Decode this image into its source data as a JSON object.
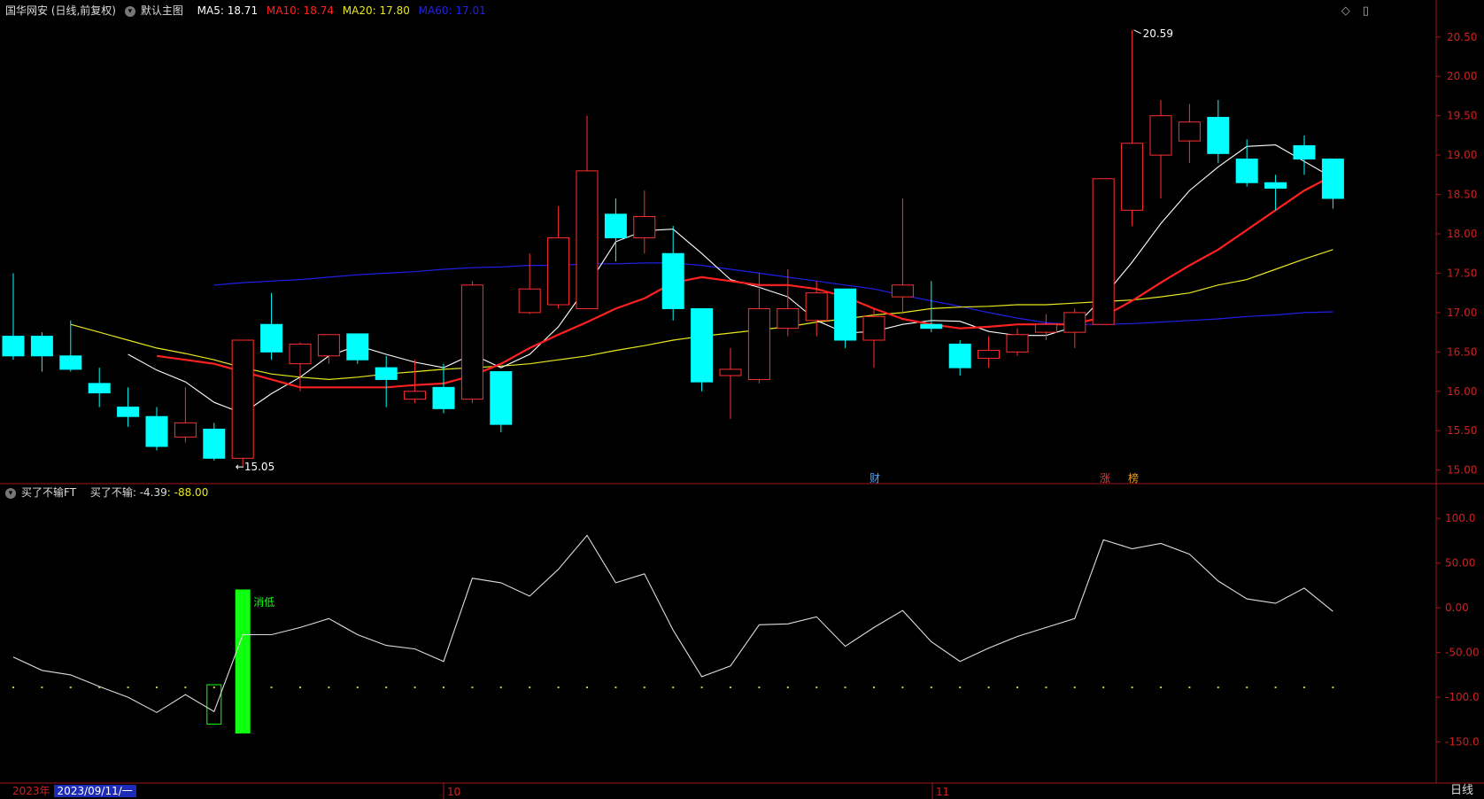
{
  "header": {
    "stock_title": "国华网安 (日线,前复权)",
    "main_chart_label": "默认主图",
    "ma5_label": "MA5: 18.71",
    "ma10_label": "MA10: 18.74",
    "ma20_label": "MA20: 17.80",
    "ma60_label": "MA60: 17.01",
    "colors": {
      "ma5": "#ffffff",
      "ma10": "#ff2020",
      "ma20": "#e8e820",
      "ma60": "#2020e8"
    }
  },
  "sub_header": {
    "indicator_name": "买了不输FT",
    "indicator_label": "买了不输: -4.39",
    "indicator_value": ": -88.00"
  },
  "window_icons": [
    "diamond-icon",
    "document-icon"
  ],
  "price_axis": {
    "ticks": [
      "20.50",
      "20.00",
      "19.50",
      "19.00",
      "18.50",
      "18.00",
      "17.50",
      "17.00",
      "16.50",
      "16.00",
      "15.50",
      "15.00"
    ]
  },
  "indicator_axis": {
    "ticks": [
      "100.0",
      "50.00",
      "0.00",
      "-50.00",
      "-100.0",
      "-150.0"
    ]
  },
  "annotations": {
    "high": "20.59",
    "low": "15.05",
    "signal": "消低",
    "badge_cai": "财",
    "badge_zhang": "涨",
    "badge_bang": "榜"
  },
  "time_axis": {
    "year": "2023年",
    "date": "2023/09/11/一",
    "month_10": "10",
    "month_11": "11",
    "period": "日线"
  },
  "chart_data": {
    "type": "candlestick",
    "candles": [
      [
        16.7,
        16.45,
        17.5,
        16.4
      ],
      [
        16.7,
        16.45,
        16.75,
        16.25
      ],
      [
        16.45,
        16.28,
        16.9,
        16.25
      ],
      [
        16.1,
        15.98,
        16.3,
        15.8
      ],
      [
        15.8,
        15.68,
        16.05,
        15.55
      ],
      [
        15.68,
        15.3,
        15.8,
        15.25
      ],
      [
        15.42,
        15.6,
        16.05,
        15.35
      ],
      [
        15.52,
        15.15,
        15.6,
        15.12
      ],
      [
        15.15,
        16.65,
        16.65,
        15.05
      ],
      [
        16.85,
        16.5,
        17.25,
        16.4
      ],
      [
        16.35,
        16.6,
        16.62,
        16.0
      ],
      [
        16.45,
        16.72,
        16.72,
        16.35
      ],
      [
        16.73,
        16.4,
        16.73,
        16.35
      ],
      [
        16.3,
        16.15,
        16.45,
        15.8
      ],
      [
        15.9,
        16.0,
        16.4,
        15.85
      ],
      [
        16.05,
        15.78,
        16.35,
        15.72
      ],
      [
        15.9,
        17.35,
        17.4,
        15.85
      ],
      [
        16.25,
        15.58,
        16.25,
        15.48
      ],
      [
        17.0,
        17.3,
        17.75,
        16.98
      ],
      [
        17.1,
        17.95,
        18.35,
        17.05
      ],
      [
        17.05,
        18.8,
        19.5,
        17.15
      ],
      [
        18.25,
        17.95,
        18.45,
        17.65
      ],
      [
        17.95,
        18.22,
        18.55,
        17.75
      ],
      [
        17.75,
        17.05,
        18.1,
        16.9
      ],
      [
        17.05,
        16.12,
        17.05,
        16.0
      ],
      [
        16.2,
        16.28,
        16.55,
        15.65
      ],
      [
        16.15,
        17.05,
        17.5,
        16.1
      ],
      [
        16.8,
        17.05,
        17.55,
        16.7
      ],
      [
        16.9,
        17.25,
        17.4,
        16.7
      ],
      [
        17.3,
        16.65,
        17.3,
        16.55
      ],
      [
        16.65,
        16.95,
        17.05,
        16.3
      ],
      [
        17.2,
        17.35,
        18.45,
        16.98
      ],
      [
        16.85,
        16.8,
        17.4,
        16.75
      ],
      [
        16.6,
        16.3,
        16.65,
        16.2
      ],
      [
        16.42,
        16.52,
        16.7,
        16.3
      ],
      [
        16.5,
        16.72,
        16.8,
        16.45
      ],
      [
        16.75,
        16.85,
        16.98,
        16.65
      ],
      [
        16.75,
        17.0,
        17.05,
        16.55
      ],
      [
        16.85,
        18.7,
        18.7,
        16.85
      ],
      [
        18.3,
        19.15,
        20.59,
        18.1
      ],
      [
        19.0,
        19.5,
        19.7,
        18.45
      ],
      [
        19.18,
        19.42,
        19.65,
        18.9
      ],
      [
        19.48,
        19.02,
        19.7,
        18.9
      ],
      [
        18.95,
        18.65,
        19.2,
        18.6
      ],
      [
        18.65,
        18.58,
        18.75,
        18.3
      ],
      [
        19.12,
        18.95,
        19.25,
        18.75
      ],
      [
        18.95,
        18.45,
        18.95,
        18.32
      ]
    ],
    "ma5": [
      null,
      null,
      null,
      null,
      16.47,
      16.27,
      16.12,
      15.86,
      15.72,
      15.97,
      16.18,
      16.45,
      16.58,
      16.47,
      16.37,
      16.3,
      16.47,
      16.3,
      16.47,
      16.82,
      17.33,
      17.9,
      18.04,
      18.06,
      17.75,
      17.42,
      17.32,
      17.2,
      16.9,
      16.74,
      16.76,
      16.85,
      16.9,
      16.89,
      16.76,
      16.71,
      16.71,
      16.82,
      17.2,
      17.64,
      18.13,
      18.55,
      18.85,
      19.11,
      19.13,
      18.92,
      18.71
    ],
    "ma10": [
      16.45,
      16.4,
      16.35,
      16.25,
      16.15,
      16.05,
      16.05,
      16.05,
      16.05,
      16.08,
      16.1,
      16.2,
      16.35,
      16.55,
      16.72,
      16.88,
      17.05,
      17.18,
      17.38,
      17.45,
      17.4,
      17.35,
      17.35,
      17.3,
      17.2,
      17.05,
      16.92,
      16.85,
      16.8,
      16.82,
      16.85,
      16.85,
      16.85,
      16.95,
      17.15,
      17.38,
      17.6,
      17.8,
      18.05,
      18.3,
      18.55,
      18.74
    ],
    "ma20": [
      16.85,
      16.75,
      16.65,
      16.55,
      16.48,
      16.4,
      16.3,
      16.22,
      16.18,
      16.15,
      16.18,
      16.22,
      16.25,
      16.28,
      16.3,
      16.32,
      16.35,
      16.4,
      16.45,
      16.52,
      16.58,
      16.65,
      16.7,
      16.74,
      16.78,
      16.82,
      16.88,
      16.92,
      16.97,
      17.0,
      17.05,
      17.07,
      17.08,
      17.1,
      17.1,
      17.12,
      17.14,
      17.16,
      17.2,
      17.25,
      17.35,
      17.42,
      17.55,
      17.68,
      17.8
    ],
    "ma60": [
      17.35,
      17.38,
      17.4,
      17.42,
      17.45,
      17.48,
      17.5,
      17.52,
      17.55,
      17.57,
      17.58,
      17.6,
      17.6,
      17.62,
      17.62,
      17.63,
      17.63,
      17.6,
      17.55,
      17.5,
      17.45,
      17.4,
      17.35,
      17.3,
      17.22,
      17.15,
      17.08,
      17.0,
      16.93,
      16.87,
      16.85,
      16.85,
      16.86,
      16.88,
      16.9,
      16.92,
      16.95,
      16.97,
      17.0,
      17.01
    ],
    "indicator": [
      -55,
      -70,
      -75,
      -88,
      -100,
      -117,
      -97,
      -116,
      -30,
      -30,
      -22,
      -12,
      -30,
      -42,
      -46,
      -60,
      33,
      28,
      13,
      43,
      81,
      28,
      38,
      -25,
      -77,
      -65,
      -19,
      -18,
      -10,
      -43,
      -22,
      -3,
      -38,
      -60,
      -45,
      -32,
      -22,
      -12,
      76,
      66,
      72,
      60,
      30,
      10,
      5,
      22,
      -4
    ],
    "signal_bars": [
      {
        "index": 7,
        "from": -130,
        "to": -86,
        "filled": false
      },
      {
        "index": 8,
        "from": -140,
        "to": 20,
        "filled": true
      }
    ],
    "price_ylim": [
      14.85,
      20.7
    ],
    "indicator_ylim": [
      -190,
      120
    ]
  }
}
